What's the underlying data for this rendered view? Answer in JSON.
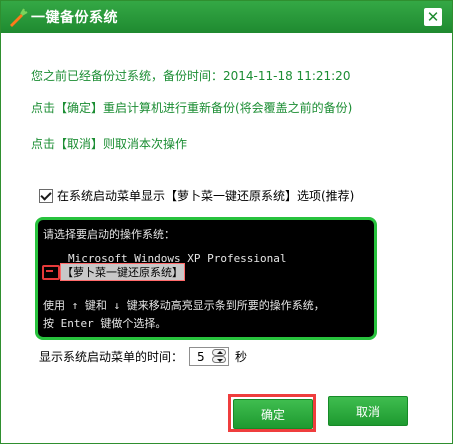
{
  "window": {
    "title": "一键备份系统",
    "close_symbol": "✕"
  },
  "info_lines": [
    "您之前已经备份过系统，备份时间：2014-11-18 11:21:20",
    "点击【确定】重启计算机进行重新备份(将会覆盖之前的备份)",
    "点击【取消】则取消本次操作"
  ],
  "checkbox": {
    "label": "在系统启动菜单显示【萝卜菜一键还原系统】选项(推荐)",
    "checked": true
  },
  "boot_menu": {
    "prompt": "请选择要启动的操作系统：",
    "option_1": "Microsoft Windows XP Professional",
    "option_2": "【萝卜菜一键还原系统】",
    "help_line_1": "使用 ↑ 键和 ↓ 键来移动高亮显示条到所要的操作系统，",
    "help_line_2": "按 Enter 键做个选择。"
  },
  "timeout": {
    "label": "显示系统启动菜单的时间：",
    "value": "5",
    "unit": "秒"
  },
  "buttons": {
    "ok": "确定",
    "cancel": "取消"
  },
  "colors": {
    "title_bar": "#1f8a30",
    "accent_green": "#28c23d",
    "info_text": "#1b8d33",
    "highlight_red": "#ef3d3d"
  },
  "icons": {
    "app_icon": "carrot-icon",
    "close": "close-icon",
    "checkbox": "checkmark-icon",
    "spin_up": "chevron-up-icon",
    "spin_down": "chevron-down-icon"
  }
}
